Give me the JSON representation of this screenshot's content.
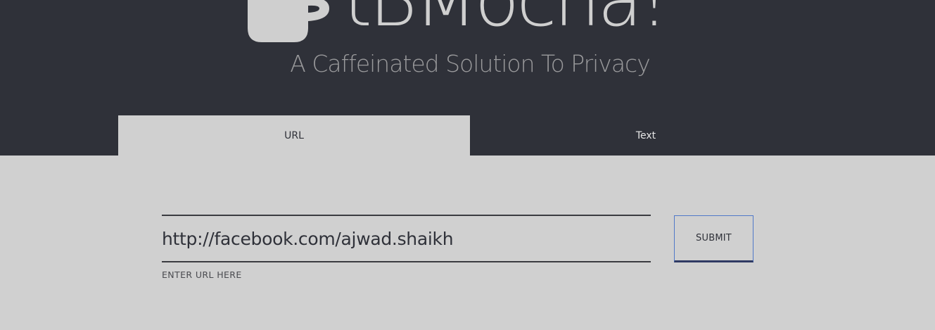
{
  "header": {
    "brand": "tBMocha!",
    "tagline": "A Caffeinated Solution To Privacy",
    "logo_icon": "coffee-mug-icon"
  },
  "tabs": [
    {
      "label": "URL",
      "active": true
    },
    {
      "label": "Text",
      "active": false
    }
  ],
  "form": {
    "url_value": "http://facebook.com/ajwad.shaikh",
    "url_label": "ENTER URL HERE",
    "submit_label": "SUBMIT"
  },
  "colors": {
    "header_bg": "#2f3139",
    "page_bg": "#d0d0d0",
    "text_light": "#cfcfcf",
    "button_border": "#4f78c9"
  }
}
